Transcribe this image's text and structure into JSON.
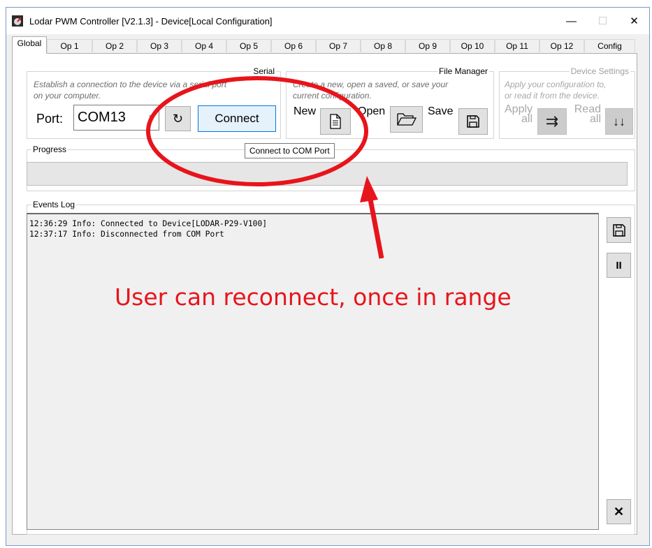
{
  "window": {
    "title": "Lodar PWM Controller [V2.1.3] - Device[Local Configuration]",
    "controls": {
      "minimize": "—",
      "maximize": "☐",
      "close": "✕"
    }
  },
  "tabs": [
    "Global",
    "Op 1",
    "Op 2",
    "Op 3",
    "Op 4",
    "Op 5",
    "Op 6",
    "Op 7",
    "Op 8",
    "Op 9",
    "Op 10",
    "Op 11",
    "Op 12",
    "Config"
  ],
  "active_tab": "Global",
  "serial": {
    "group_title": "Serial",
    "description_line1": "Establish a connection to the device via a serial port",
    "description_line2": "on your computer.",
    "port_label": "Port:",
    "port_value": "COM13",
    "refresh_icon": "↻",
    "connect_label": "Connect"
  },
  "file_manager": {
    "group_title": "File Manager",
    "description_line1": "Create a new, open a saved, or save your",
    "description_line2": "current configuration.",
    "new_label": "New",
    "open_label": "Open",
    "save_label": "Save"
  },
  "device_settings": {
    "group_title": "Device Settings",
    "description_line1": "Apply your configuration to,",
    "description_line2": "or read it from the device.",
    "apply_line1": "Apply",
    "apply_line2": "all",
    "read_line1": "Read",
    "read_line2": "all",
    "apply_icon": "⇉",
    "read_icon": "↓↓"
  },
  "progress": {
    "group_title": "Progress",
    "value": 0
  },
  "tooltip": "Connect to COM Port",
  "events_log": {
    "group_title": "Events Log",
    "lines": [
      "12:36:29 Info: Connected to Device[LODAR-P29-V100]",
      "12:37:17 Info: Disconnected from COM Port"
    ],
    "pause_icon": "II",
    "clear_icon": "✕"
  },
  "annotation": {
    "text": "User can reconnect, once in range",
    "color": "#e8141b"
  },
  "icons": [
    "app-icon",
    "refresh-icon",
    "new-file-icon",
    "open-folder-icon",
    "save-disk-icon",
    "apply-arrows-icon",
    "read-arrows-icon",
    "log-save-icon",
    "pause-icon",
    "clear-icon"
  ]
}
